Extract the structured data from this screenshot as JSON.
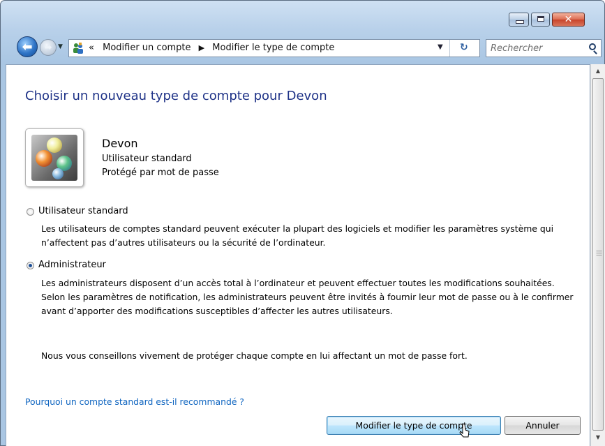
{
  "window": {
    "controls": {
      "minimize": "minimize",
      "maximize": "maximize",
      "close": "✕"
    }
  },
  "navigation": {
    "breadcrumb": [
      "Modifier un compte",
      "Modifier le type de compte"
    ],
    "breadcrumb_overflow": "«",
    "separator": "▶",
    "search_placeholder": "Rechercher"
  },
  "page": {
    "title": "Choisir un nouveau type de compte pour Devon",
    "user": {
      "name": "Devon",
      "type": "Utilisateur standard",
      "protection": "Protégé par mot de passe"
    },
    "options": [
      {
        "label": "Utilisateur standard",
        "selected": false,
        "description": "Les utilisateurs de comptes standard peuvent exécuter la plupart des logiciels et modifier les paramètres système qui n’affectent pas d’autres utilisateurs ou la sécurité de l’ordinateur."
      },
      {
        "label": "Administrateur",
        "selected": true,
        "description": "Les administrateurs disposent d’un accès total à l’ordinateur et peuvent effectuer toutes les modifications souhaitées. Selon les paramètres de notification, les administrateurs peuvent être invités à fournir leur mot de passe ou à le confirmer avant d’apporter des modifications susceptibles d’affecter les autres utilisateurs."
      }
    ],
    "advice": "Nous vous conseillons vivement de protéger chaque compte en lui affectant un mot de passe fort.",
    "help_link": "Pourquoi un compte standard est-il recommandé ?"
  },
  "buttons": {
    "primary": "Modifier le type de compte",
    "cancel": "Annuler"
  },
  "icons": [
    "back-arrow-icon",
    "forward-arrow-icon",
    "user-accounts-icon",
    "refresh-icon",
    "search-icon",
    "user-avatar-marbles-icon",
    "mouse-cursor-icon"
  ],
  "colors": {
    "title": "#1e3287",
    "link": "#0f65c0",
    "selected_radio": "#1d4f96"
  }
}
